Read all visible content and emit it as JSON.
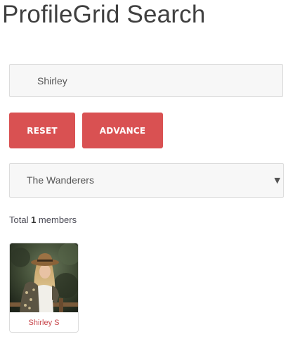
{
  "page": {
    "title": "ProfileGrid Search"
  },
  "search": {
    "value": "Shirley"
  },
  "buttons": {
    "reset_label": "RESET",
    "advance_label": "ADVANCE"
  },
  "group_select": {
    "selected": "The Wanderers"
  },
  "results": {
    "total_prefix": "Total ",
    "total_count": "1",
    "total_suffix": " members",
    "members": [
      {
        "name": "Shirley S"
      }
    ]
  },
  "colors": {
    "accent": "#d95152",
    "member_name": "#c8464b",
    "field_background": "#f7f7f7",
    "field_border": "#dcdcdc"
  },
  "icons": {
    "select_arrow": "caret-down-icon"
  }
}
